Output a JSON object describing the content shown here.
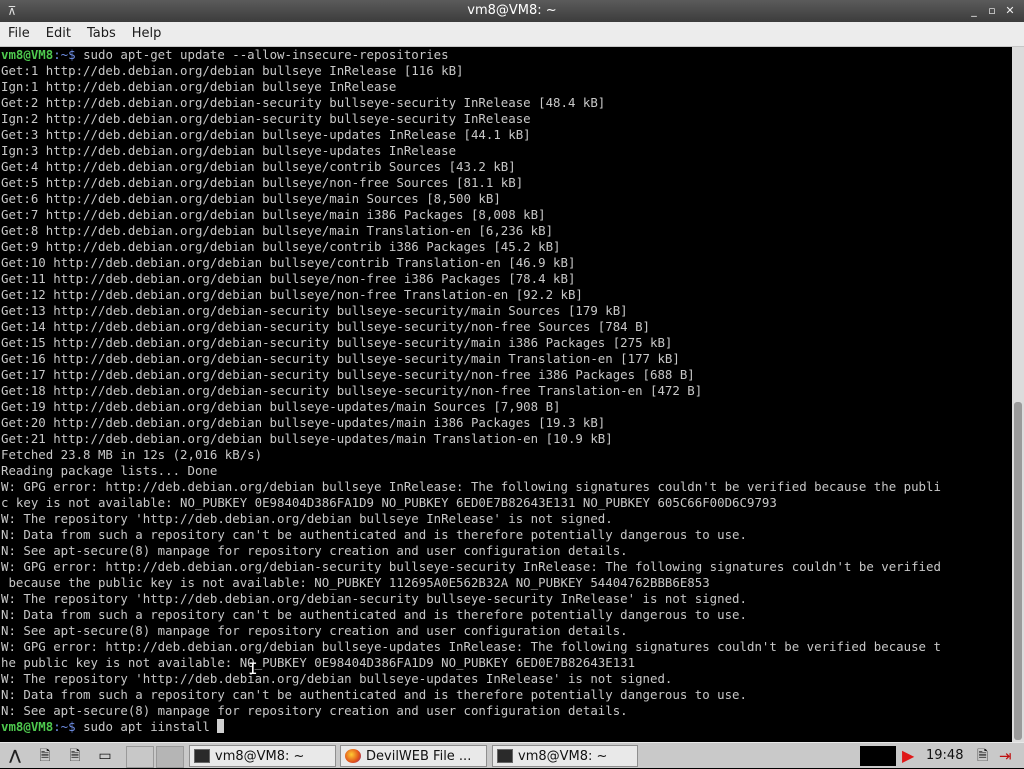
{
  "window": {
    "title": "vm8@VM8: ~",
    "controls": {
      "minimize": "_",
      "maximize": "▫",
      "close": "✕"
    }
  },
  "menubar": {
    "items": [
      "File",
      "Edit",
      "Tabs",
      "Help"
    ]
  },
  "terminal": {
    "prompt_user": "vm8@VM8",
    "prompt_path": ":~$",
    "command_1": " sudo apt-get update --allow-insecure-repositories",
    "output_lines": [
      "Get:1 http://deb.debian.org/debian bullseye InRelease [116 kB]",
      "Ign:1 http://deb.debian.org/debian bullseye InRelease",
      "Get:2 http://deb.debian.org/debian-security bullseye-security InRelease [48.4 kB]",
      "Ign:2 http://deb.debian.org/debian-security bullseye-security InRelease",
      "Get:3 http://deb.debian.org/debian bullseye-updates InRelease [44.1 kB]",
      "Ign:3 http://deb.debian.org/debian bullseye-updates InRelease",
      "Get:4 http://deb.debian.org/debian bullseye/contrib Sources [43.2 kB]",
      "Get:5 http://deb.debian.org/debian bullseye/non-free Sources [81.1 kB]",
      "Get:6 http://deb.debian.org/debian bullseye/main Sources [8,500 kB]",
      "Get:7 http://deb.debian.org/debian bullseye/main i386 Packages [8,008 kB]",
      "Get:8 http://deb.debian.org/debian bullseye/main Translation-en [6,236 kB]",
      "Get:9 http://deb.debian.org/debian bullseye/contrib i386 Packages [45.2 kB]",
      "Get:10 http://deb.debian.org/debian bullseye/contrib Translation-en [46.9 kB]",
      "Get:11 http://deb.debian.org/debian bullseye/non-free i386 Packages [78.4 kB]",
      "Get:12 http://deb.debian.org/debian bullseye/non-free Translation-en [92.2 kB]",
      "Get:13 http://deb.debian.org/debian-security bullseye-security/main Sources [179 kB]",
      "Get:14 http://deb.debian.org/debian-security bullseye-security/non-free Sources [784 B]",
      "Get:15 http://deb.debian.org/debian-security bullseye-security/main i386 Packages [275 kB]",
      "Get:16 http://deb.debian.org/debian-security bullseye-security/main Translation-en [177 kB]",
      "Get:17 http://deb.debian.org/debian-security bullseye-security/non-free i386 Packages [688 B]",
      "Get:18 http://deb.debian.org/debian-security bullseye-security/non-free Translation-en [472 B]",
      "Get:19 http://deb.debian.org/debian bullseye-updates/main Sources [7,908 B]",
      "Get:20 http://deb.debian.org/debian bullseye-updates/main i386 Packages [19.3 kB]",
      "Get:21 http://deb.debian.org/debian bullseye-updates/main Translation-en [10.9 kB]",
      "Fetched 23.8 MB in 12s (2,016 kB/s)",
      "Reading package lists... Done",
      "W: GPG error: http://deb.debian.org/debian bullseye InRelease: The following signatures couldn't be verified because the publi",
      "c key is not available: NO_PUBKEY 0E98404D386FA1D9 NO_PUBKEY 6ED0E7B82643E131 NO_PUBKEY 605C66F00D6C9793",
      "W: The repository 'http://deb.debian.org/debian bullseye InRelease' is not signed.",
      "N: Data from such a repository can't be authenticated and is therefore potentially dangerous to use.",
      "N: See apt-secure(8) manpage for repository creation and user configuration details.",
      "W: GPG error: http://deb.debian.org/debian-security bullseye-security InRelease: The following signatures couldn't be verified",
      " because the public key is not available: NO_PUBKEY 112695A0E562B32A NO_PUBKEY 54404762BBB6E853",
      "W: The repository 'http://deb.debian.org/debian-security bullseye-security InRelease' is not signed.",
      "N: Data from such a repository can't be authenticated and is therefore potentially dangerous to use.",
      "N: See apt-secure(8) manpage for repository creation and user configuration details.",
      "W: GPG error: http://deb.debian.org/debian bullseye-updates InRelease: The following signatures couldn't be verified because t",
      "he public key is not available: NO_PUBKEY 0E98404D386FA1D9 NO_PUBKEY 6ED0E7B82643E131",
      "W: The repository 'http://deb.debian.org/debian bullseye-updates InRelease' is not signed.",
      "N: Data from such a repository can't be authenticated and is therefore potentially dangerous to use.",
      "N: See apt-secure(8) manpage for repository creation and user configuration details."
    ],
    "command_2": " sudo apt iinstall "
  },
  "taskbar": {
    "tasks": [
      {
        "label": "vm8@VM8: ~",
        "icon": "terminal-icon"
      },
      {
        "label": "DevilWEB File ...",
        "icon": "browser-icon"
      },
      {
        "label": "vm8@VM8: ~",
        "icon": "terminal-icon"
      }
    ],
    "clock": "19:48"
  },
  "colors": {
    "prompt_user": "#4ec94e",
    "prompt_path": "#6f8fe6",
    "terminal_bg": "#000000",
    "terminal_fg": "#c8c8c8",
    "titlebar_bg": "#4a4a4a",
    "taskbar_bg": "#c9c9c9"
  }
}
